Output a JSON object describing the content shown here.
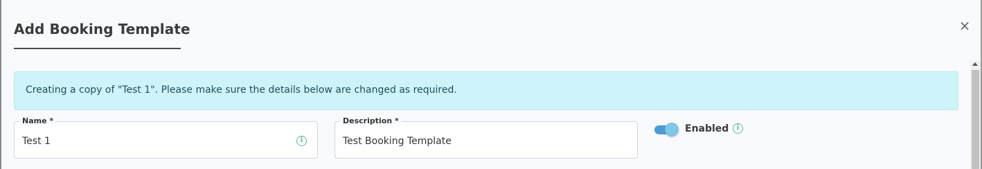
{
  "dialog": {
    "title": "Add Booking Template",
    "close_glyph": "×",
    "close_icon": "close-icon"
  },
  "banner": {
    "text": "Creating a copy of \"Test 1\". Please make sure the details below are changed as required.",
    "background": "#cef3f8"
  },
  "form": {
    "name": {
      "label": "Name *",
      "value": "Test 1",
      "icon": "info-icon",
      "info_glyph": "i"
    },
    "description": {
      "label": "Description *",
      "value": "Test Booking Template"
    },
    "enabled": {
      "label": "Enabled",
      "checked": true,
      "icon": "info-icon",
      "info_glyph": "i"
    }
  },
  "colors": {
    "accent": "#4b9bd8",
    "info_icon": "#5fb89a"
  }
}
